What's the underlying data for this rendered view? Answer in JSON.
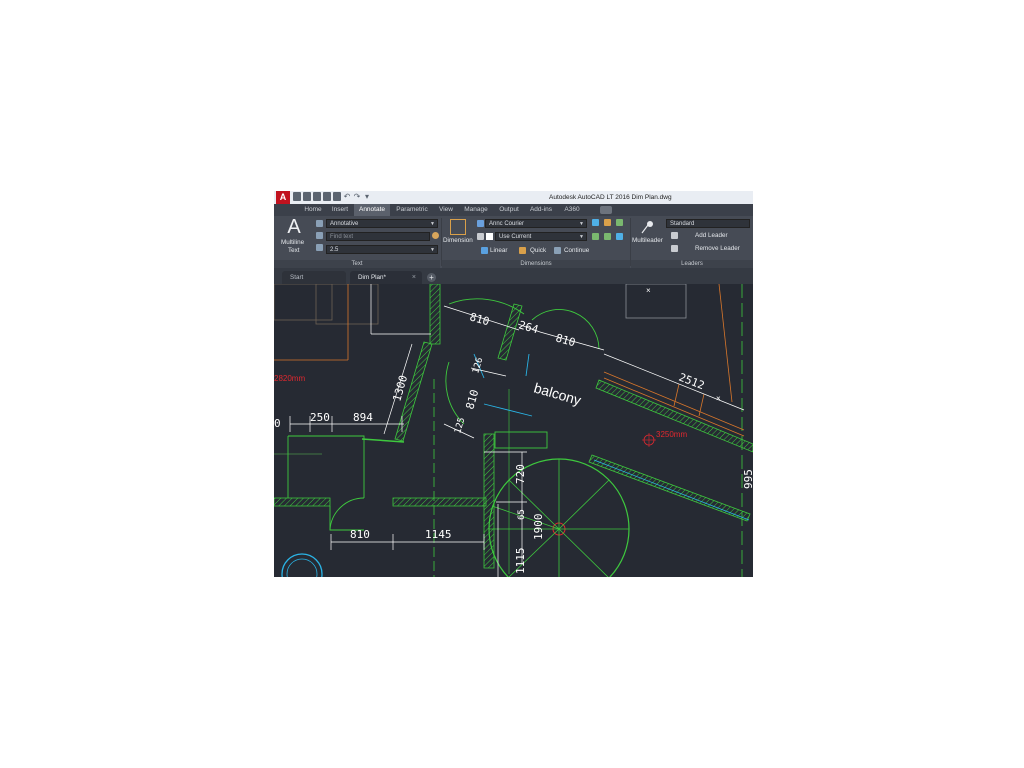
{
  "app": {
    "logo": "A",
    "window_title": "Autodesk AutoCAD LT 2016   Dim Plan.dwg"
  },
  "ribbon_tabs": [
    "Home",
    "Insert",
    "Annotate",
    "Parametric",
    "View",
    "Manage",
    "Output",
    "Add-ins",
    "A360"
  ],
  "active_tab": "Annotate",
  "text_panel": {
    "multiline_label_1": "Multiline",
    "multiline_label_2": "Text",
    "text_style": "Annotative",
    "find_placeholder": "Find text",
    "text_height": "2.5",
    "title": "Text"
  },
  "dimensions_panel": {
    "dimension_label": "Dimension",
    "dim_style": "Annc Courier",
    "dim_layer": "Use Current",
    "linear_label": "Linear",
    "quick_label": "Quick",
    "continue_label": "Continue",
    "title": "Dimensions"
  },
  "leaders_panel": {
    "multileader_label": "Multileader",
    "leader_style": "Standard",
    "add_leader": "Add Leader",
    "remove_leader": "Remove Leader",
    "title": "Leaders"
  },
  "doc_tabs": [
    "Start",
    "Dim Plan*"
  ],
  "drawing": {
    "dimensions": {
      "d810_top": "810",
      "d264": "264",
      "d810_right": "810",
      "d2512": "2512",
      "d1300": "1300",
      "d126": "126",
      "d810_mid": "810",
      "d250": "250",
      "d894": "894",
      "d125": "125",
      "d720": "720",
      "d65": "65",
      "d1900": "1900",
      "d810_bottom": "810",
      "d1145": "1145",
      "d1115": "1115",
      "d995": "995",
      "d0": "0"
    },
    "room_label": "balcony",
    "red_area_left": "2820mm",
    "red_area_right": "3250mm"
  },
  "colors": {
    "wall": "#3ec93e",
    "dimension": "#ffffff",
    "accent_orange": "#d9772b",
    "accent_cyan": "#2ab4e6",
    "area_red": "#e0282f"
  }
}
